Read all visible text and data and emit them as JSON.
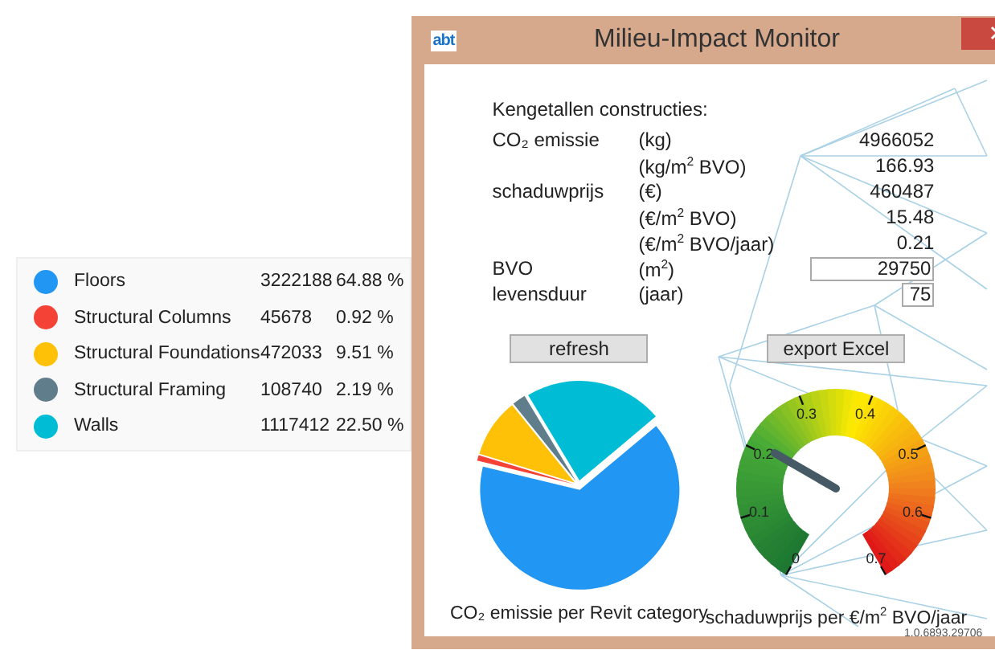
{
  "legend": {
    "items": [
      {
        "value": "3222188",
        "percent": "64.88 %",
        "color": "#2196f3"
      },
      {
        "value": "45678",
        "percent": "0.92 %",
        "color": "#f44336"
      },
      {
        "value": "472033",
        "percent": "9.51 %",
        "color": "#ffc107"
      },
      {
        "value": "108740",
        "percent": "2.19 %",
        "color": "#607d8b"
      },
      {
        "value": "1117412",
        "percent": "22.50 %",
        "color": "#00bcd4"
      }
    ]
  },
  "window": {
    "logo": "abt",
    "title": "Milieu-Impact Monitor"
  },
  "heading": "Kengetallen constructies:",
  "rows": [
    {
      "kind": "text",
      "label": "CO₂ emissie",
      "unit": "(kg)",
      "value": "4966052"
    },
    {
      "kind": "text",
      "unit": "(kg/m$^{2}$ BVO)",
      "value": "166.93"
    },
    {
      "kind": "text",
      "label": "schaduwprijs",
      "unit": "(€)",
      "value": "460487"
    },
    {
      "kind": "text",
      "unit": "(€/m$^{2}$ BVO)",
      "value": "15.48"
    },
    {
      "kind": "text",
      "unit": "(€/m$^{2}$ BVO/jaar)",
      "value": "0.21"
    },
    {
      "kind": "field",
      "label": "BVO",
      "unit": "(m$^{2}$)",
      "value": "29750"
    },
    {
      "kind": "short_field",
      "label": "levensduur",
      "unit": "(jaar)",
      "value": "75"
    }
  ],
  "buttons": [
    {
      "label": "refresh"
    },
    {
      "label": "export Excel"
    }
  ],
  "pie": {
    "caption": "CO₂ emissie per Revit category",
    "chart_data": {
      "type": "pie",
      "categories": [
        "Floors",
        "Structural Columns",
        "Structural Foundations",
        "Structural Framing",
        "Walls"
      ],
      "values": [
        64.88,
        0.92,
        9.51,
        2.19,
        22.5
      ]
    }
  },
  "gauge": {
    "caption": "schaduwprijs per €/m$^{2}$ BVO/jaar",
    "ticks": [
      "0",
      "0.1",
      "0.2",
      "0.3",
      "0.4",
      "0.5",
      "0.6",
      "0.7"
    ],
    "level": 0.3
  },
  "version": "1.0.6893.29706"
}
